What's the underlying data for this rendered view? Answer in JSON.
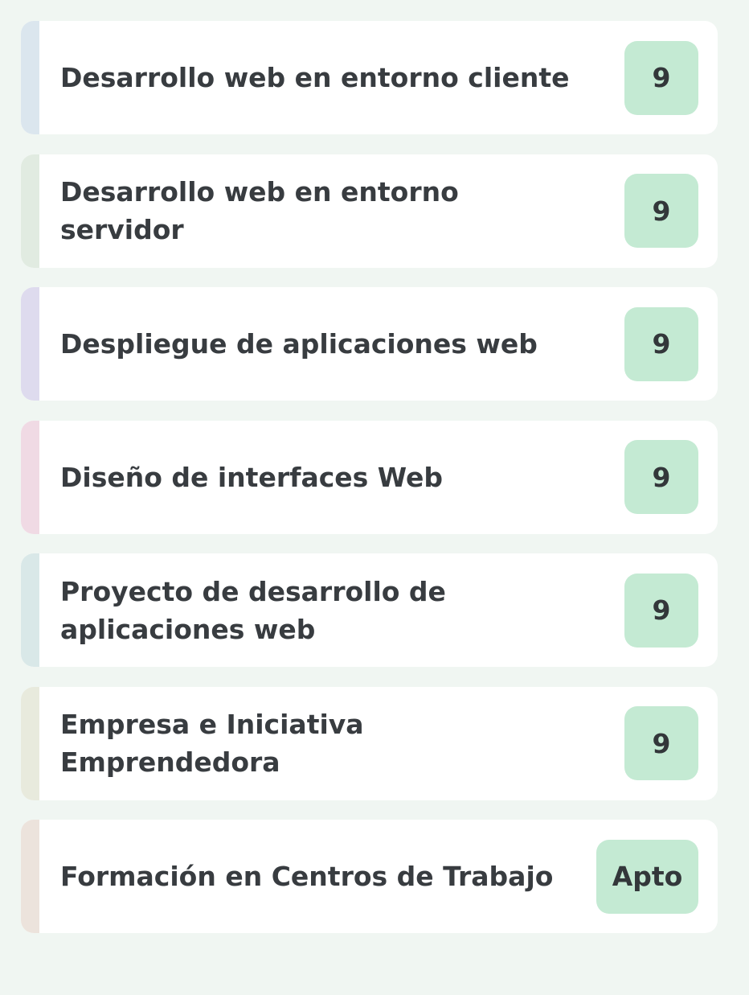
{
  "subjects": [
    {
      "name": "Desarrollo web en entorno cliente",
      "grade": "9",
      "accent": "#dbe6ee"
    },
    {
      "name": "Desarrollo web en entorno servidor",
      "grade": "9",
      "accent": "#e1ebe1"
    },
    {
      "name": "Despliegue de aplicaciones web",
      "grade": "9",
      "accent": "#dedbee"
    },
    {
      "name": "Diseño de interfaces Web",
      "grade": "9",
      "accent": "#f0dae4"
    },
    {
      "name": "Proyecto de desarrollo de aplicaciones web",
      "grade": "9",
      "accent": "#d9e8e8"
    },
    {
      "name": "Empresa e Iniciativa Emprendedora",
      "grade": "9",
      "accent": "#e8eadd"
    },
    {
      "name": "Formación en Centros de Trabajo",
      "grade": "Apto",
      "accent": "#ece3dc"
    }
  ],
  "colors": {
    "background": "#f0f6f2",
    "card": "#ffffff",
    "badge": "#c4ead3",
    "text": "#383c40"
  }
}
